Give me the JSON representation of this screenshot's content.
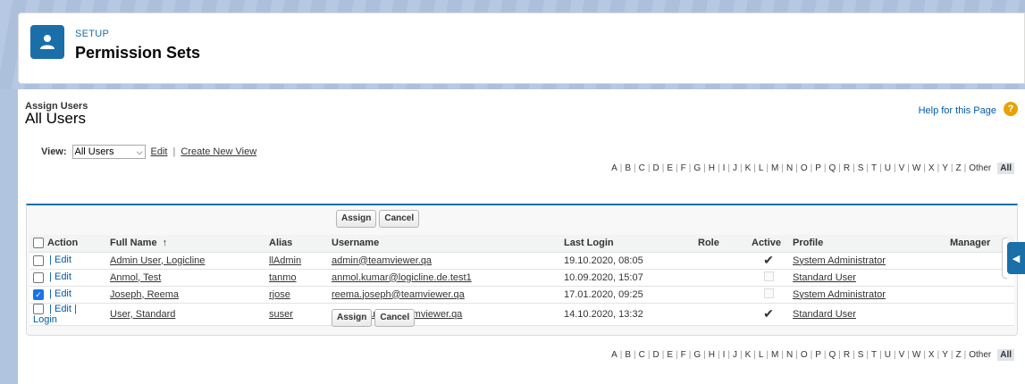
{
  "header": {
    "section": "SETUP",
    "title": "Permission Sets"
  },
  "page": {
    "subtitle": "Assign Users",
    "title": "All Users",
    "help_text": "Help for this Page",
    "help_icon": "question-icon"
  },
  "view": {
    "label": "View:",
    "selected": "All Users",
    "edit": "Edit",
    "separator": "|",
    "create": "Create New View"
  },
  "alphabet": [
    "A",
    "B",
    "C",
    "D",
    "E",
    "F",
    "G",
    "H",
    "I",
    "J",
    "K",
    "L",
    "M",
    "N",
    "O",
    "P",
    "Q",
    "R",
    "S",
    "T",
    "U",
    "V",
    "W",
    "X",
    "Y",
    "Z",
    "Other"
  ],
  "alphabet_all": "All",
  "buttons": {
    "assign": "Assign",
    "cancel": "Cancel"
  },
  "table": {
    "headers": {
      "action": "Action",
      "full_name": "Full Name",
      "sort_arrow": "↑",
      "alias": "Alias",
      "username": "Username",
      "last_login": "Last Login",
      "role": "Role",
      "active": "Active",
      "profile": "Profile",
      "manager": "Manager"
    },
    "rows": [
      {
        "checked": false,
        "actions": "| Edit",
        "full_name": "Admin User, Logicline",
        "alias": "llAdmin",
        "username": "admin@teamviewer.qa",
        "last_login": "19.10.2020, 08:05",
        "role": "",
        "active": true,
        "profile": "System Administrator",
        "manager": ""
      },
      {
        "checked": false,
        "actions": "| Edit",
        "full_name": "Anmol, Test",
        "alias": "tanmo",
        "username": "anmol.kumar@logicline.de.test1",
        "last_login": "10.09.2020, 15:07",
        "role": "",
        "active": false,
        "profile": "Standard User",
        "manager": ""
      },
      {
        "checked": true,
        "actions": "| Edit",
        "full_name": "Joseph, Reema",
        "alias": "rjose",
        "username": "reema.joseph@teamviewer.qa",
        "last_login": "17.01.2020, 09:25",
        "role": "",
        "active": false,
        "profile": "System Administrator",
        "manager": ""
      },
      {
        "checked": false,
        "actions": "| Edit | Login",
        "full_name": "User, Standard",
        "alias": "suser",
        "username": "standarduser@teamviewer.qa",
        "last_login": "14.10.2020, 13:32",
        "role": "",
        "active": true,
        "profile": "Standard User",
        "manager": ""
      }
    ]
  },
  "colors": {
    "brand": "#1b6fa8",
    "header_bg": "#b0c4df",
    "link": "#015ba7"
  }
}
